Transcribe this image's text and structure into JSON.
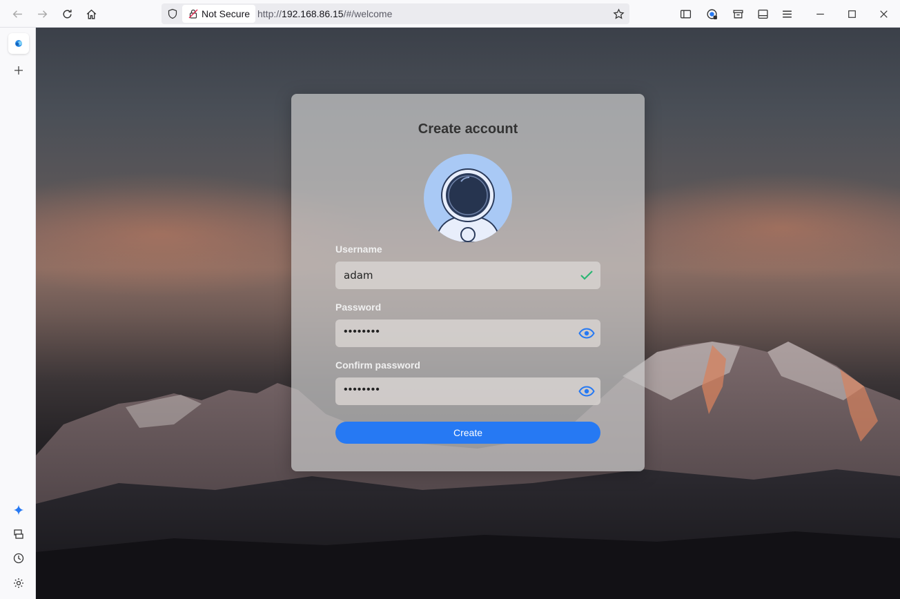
{
  "browser": {
    "security_label": "Not Secure",
    "url_prefix": "http://",
    "url_host": "192.168.86.15",
    "url_path": "/#/welcome"
  },
  "form": {
    "title": "Create account",
    "username_label": "Username",
    "username_value": "adam",
    "password_label": "Password",
    "password_value": "••••••••",
    "confirm_label": "Confirm password",
    "confirm_value": "••••••••",
    "submit_label": "Create"
  },
  "colors": {
    "accent": "#2679f3",
    "valid": "#2bb673",
    "avatar_bg": "#a9c9f5"
  },
  "icons": {
    "username_status": "check-icon",
    "password_toggle": "eye-icon",
    "confirm_toggle": "eye-icon"
  }
}
